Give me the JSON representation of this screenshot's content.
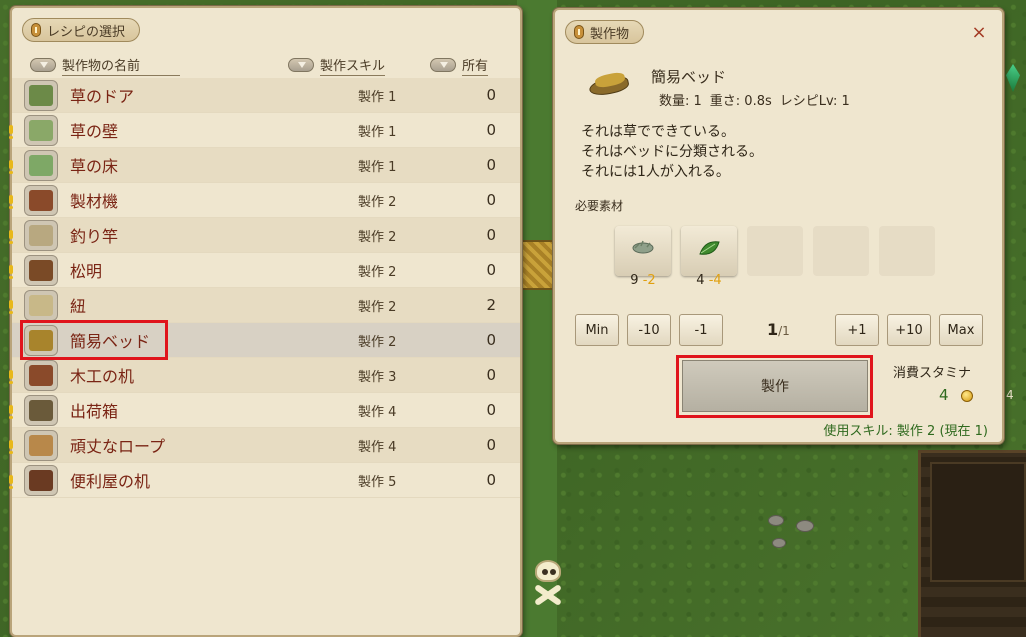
{
  "recipe_panel": {
    "title": "レシピの選択",
    "columns": {
      "name": "製作物の名前",
      "skill": "製作スキル",
      "owned": "所有"
    },
    "rows": [
      {
        "name": "草のドア",
        "skill": "製作 1",
        "owned": "0",
        "alert": false,
        "icon": "grass-door-icon",
        "color": "#6c8a48"
      },
      {
        "name": "草の壁",
        "skill": "製作 1",
        "owned": "0",
        "alert": true,
        "icon": "grass-wall-icon",
        "color": "#8aa868"
      },
      {
        "name": "草の床",
        "skill": "製作 1",
        "owned": "0",
        "alert": true,
        "icon": "grass-floor-icon",
        "color": "#7ea866"
      },
      {
        "name": "製材機",
        "skill": "製作 2",
        "owned": "0",
        "alert": true,
        "icon": "sawmill-icon",
        "color": "#8a4a2a"
      },
      {
        "name": "釣り竿",
        "skill": "製作 2",
        "owned": "0",
        "alert": true,
        "icon": "fishing-rod-icon",
        "color": "#b8a880"
      },
      {
        "name": "松明",
        "skill": "製作 2",
        "owned": "0",
        "alert": true,
        "icon": "torch-icon",
        "color": "#7a4a26"
      },
      {
        "name": "紐",
        "skill": "製作 2",
        "owned": "2",
        "alert": true,
        "icon": "string-icon",
        "color": "#c8b888"
      },
      {
        "name": "簡易ベッド",
        "skill": "製作 2",
        "owned": "0",
        "alert": false,
        "icon": "simple-bed-icon",
        "color": "#a8842c",
        "selected": true
      },
      {
        "name": "木工の机",
        "skill": "製作 3",
        "owned": "0",
        "alert": true,
        "icon": "woodwork-desk-icon",
        "color": "#8a4a2a"
      },
      {
        "name": "出荷箱",
        "skill": "製作 4",
        "owned": "0",
        "alert": true,
        "icon": "shipping-box-icon",
        "color": "#6a5a3a"
      },
      {
        "name": "頑丈なロープ",
        "skill": "製作 4",
        "owned": "0",
        "alert": true,
        "icon": "sturdy-rope-icon",
        "color": "#b8884a"
      },
      {
        "name": "便利屋の机",
        "skill": "製作 5",
        "owned": "0",
        "alert": true,
        "icon": "handyman-desk-icon",
        "color": "#6a3a22"
      }
    ]
  },
  "product_panel": {
    "title": "製作物",
    "close_glyph": "×",
    "item_name": "簡易ベッド",
    "quantity": "数量: 1",
    "weight": "重さ: 0.8s",
    "recipe_level": "レシピLv: 1",
    "description": [
      "それは草でできている。",
      "それはベッドに分類される。",
      "それには1人が入れる。"
    ],
    "materials_title": "必要素材",
    "materials": [
      {
        "icon": "grass-bundle-icon",
        "have": "9",
        "need": "-2"
      },
      {
        "icon": "leaf-icon",
        "have": "4",
        "need": "-4"
      }
    ],
    "quantity_controls": {
      "min": "Min",
      "minus10": "-10",
      "minus1": "-1",
      "current": "1",
      "max_count": "/1",
      "plus1": "+1",
      "plus10": "+10",
      "max": "Max"
    },
    "craft_label": "製作",
    "stamina_label": "消費スタミナ",
    "stamina_value": "4",
    "skill_used": "使用スキル: 製作 2 (現在 1)"
  },
  "side_number": "4"
}
